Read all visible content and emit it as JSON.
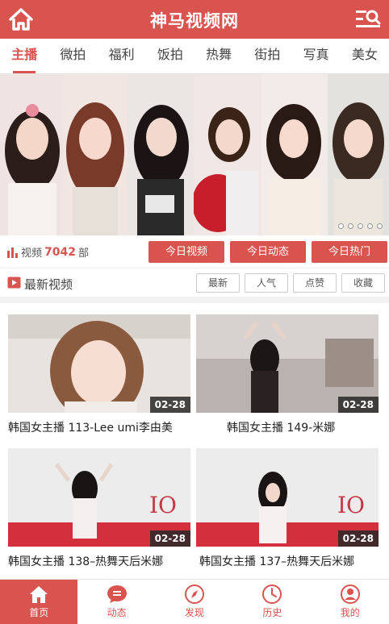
{
  "header": {
    "title": "神马视频网",
    "home_icon": "home-icon",
    "menu_icon": "search-menu-icon"
  },
  "tabs": [
    {
      "label": "主播",
      "active": true
    },
    {
      "label": "微拍"
    },
    {
      "label": "福利"
    },
    {
      "label": "饭拍"
    },
    {
      "label": "热舞"
    },
    {
      "label": "街拍"
    },
    {
      "label": "写真"
    },
    {
      "label": "美女"
    }
  ],
  "banner": {
    "slides": 5,
    "active_slide": 1
  },
  "stats": {
    "prefix": "视频",
    "count": "7042",
    "suffix": "部"
  },
  "quick_buttons": [
    "今日视频",
    "今日动态",
    "今日热门"
  ],
  "list": {
    "heading": "最新视频",
    "sort_buttons": [
      "最新",
      "人气",
      "点赞",
      "收藏"
    ]
  },
  "videos": [
    {
      "title": "韩国女主播 113-Lee umi李由美",
      "date": "02-28"
    },
    {
      "title": "韩国女主播 149-米娜",
      "date": "02-28"
    },
    {
      "title": "韩国女主播 138–热舞天后米娜",
      "date": "02-28"
    },
    {
      "title": "韩国女主播 137–热舞天后米娜",
      "date": "02-28"
    }
  ],
  "bottom_nav": [
    {
      "label": "首页",
      "icon": "home-icon",
      "active": true
    },
    {
      "label": "动态",
      "icon": "chat-icon"
    },
    {
      "label": "发现",
      "icon": "compass-icon"
    },
    {
      "label": "历史",
      "icon": "clock-icon"
    },
    {
      "label": "我的",
      "icon": "user-icon"
    }
  ],
  "colors": {
    "accent": "#d9534f"
  }
}
